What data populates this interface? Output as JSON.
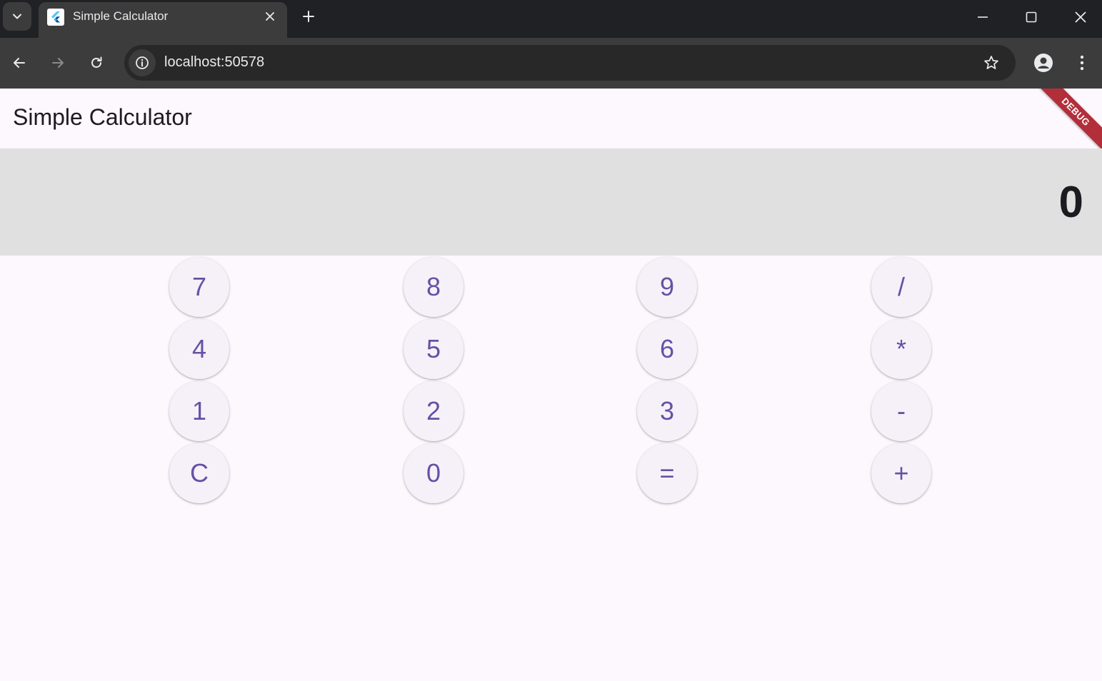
{
  "browser": {
    "tab_title": "Simple Calculator",
    "url": "localhost:50578",
    "icons": {
      "tab_search": "chevron-down-icon",
      "favicon": "flutter-logo-icon",
      "tab_close": "close-icon",
      "new_tab": "plus-icon",
      "minimize": "minimize-icon",
      "maximize": "maximize-icon",
      "close_window": "close-icon",
      "back": "arrow-left-icon",
      "forward": "arrow-right-icon",
      "reload": "reload-icon",
      "site_info": "info-icon",
      "bookmark": "star-icon",
      "profile": "person-icon",
      "menu": "more-vertical-icon"
    },
    "colors": {
      "titlebar": "#202124",
      "toolbar": "#3c3c3c",
      "omnibox": "#282828"
    }
  },
  "app": {
    "title": "Simple Calculator",
    "debug_banner": "DEBUG",
    "display": {
      "value": "0"
    },
    "keypad": {
      "rows": [
        [
          "7",
          "8",
          "9",
          "/"
        ],
        [
          "4",
          "5",
          "6",
          "*"
        ],
        [
          "1",
          "2",
          "3",
          "-"
        ],
        [
          "C",
          "0",
          "=",
          "+"
        ]
      ]
    },
    "colors": {
      "background": "#fdf7fe",
      "display_background": "#e0e0e0",
      "key_text": "#6750a4",
      "key_background": "#f6f1f8",
      "debug_banner": "#b22f3a"
    }
  }
}
